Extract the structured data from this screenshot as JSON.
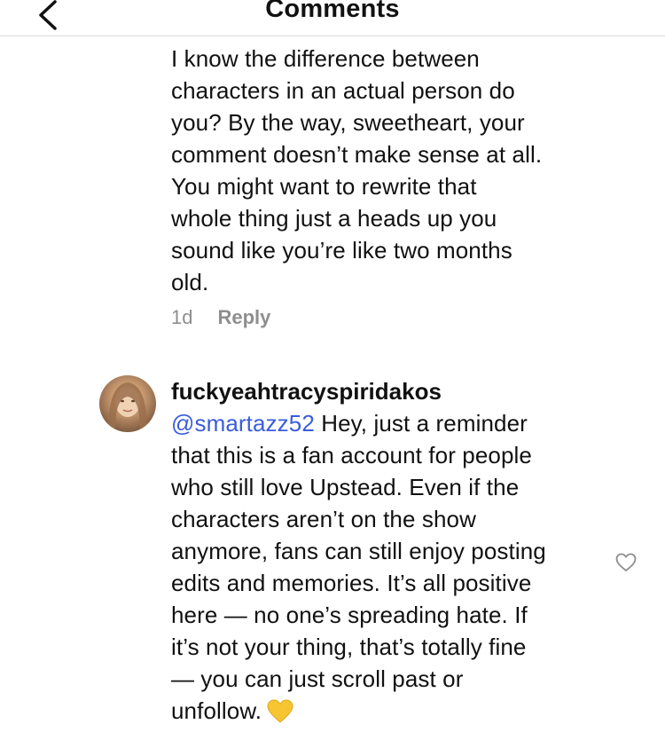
{
  "header": {
    "title": "Comments",
    "back_icon": "chevron-left-icon"
  },
  "first_comment": {
    "text": "I know the difference between\ncharacters in an actual person do\nyou? By the way, sweetheart, your\ncomment doesn’t make sense at all.\nYou might want to rewrite that\nwhole thing just a heads up you\nsound like you’re like two months\nold.",
    "time": "1d",
    "reply_label": "Reply"
  },
  "second_comment": {
    "username": "fuckyeahtracyspiridakos",
    "mention": "@smartazz52",
    "text": " Hey, just a reminder\nthat this is a fan account for people\nwho still love Upstead. Even if the\ncharacters aren’t on the show\nanymore, fans can still enjoy posting\nedits and memories. It’s all positive\nhere — no one’s spreading hate. If\nit’s not your thing, that’s totally fine\n— you can just scroll past or\nunfollow.",
    "emoji": "yellow-heart-emoji",
    "like_icon": "heart-outline-icon"
  },
  "colors": {
    "mention": "#3a5ddc",
    "meta_gray": "#8e8e8e",
    "emoji_heart": "#f7c531"
  }
}
